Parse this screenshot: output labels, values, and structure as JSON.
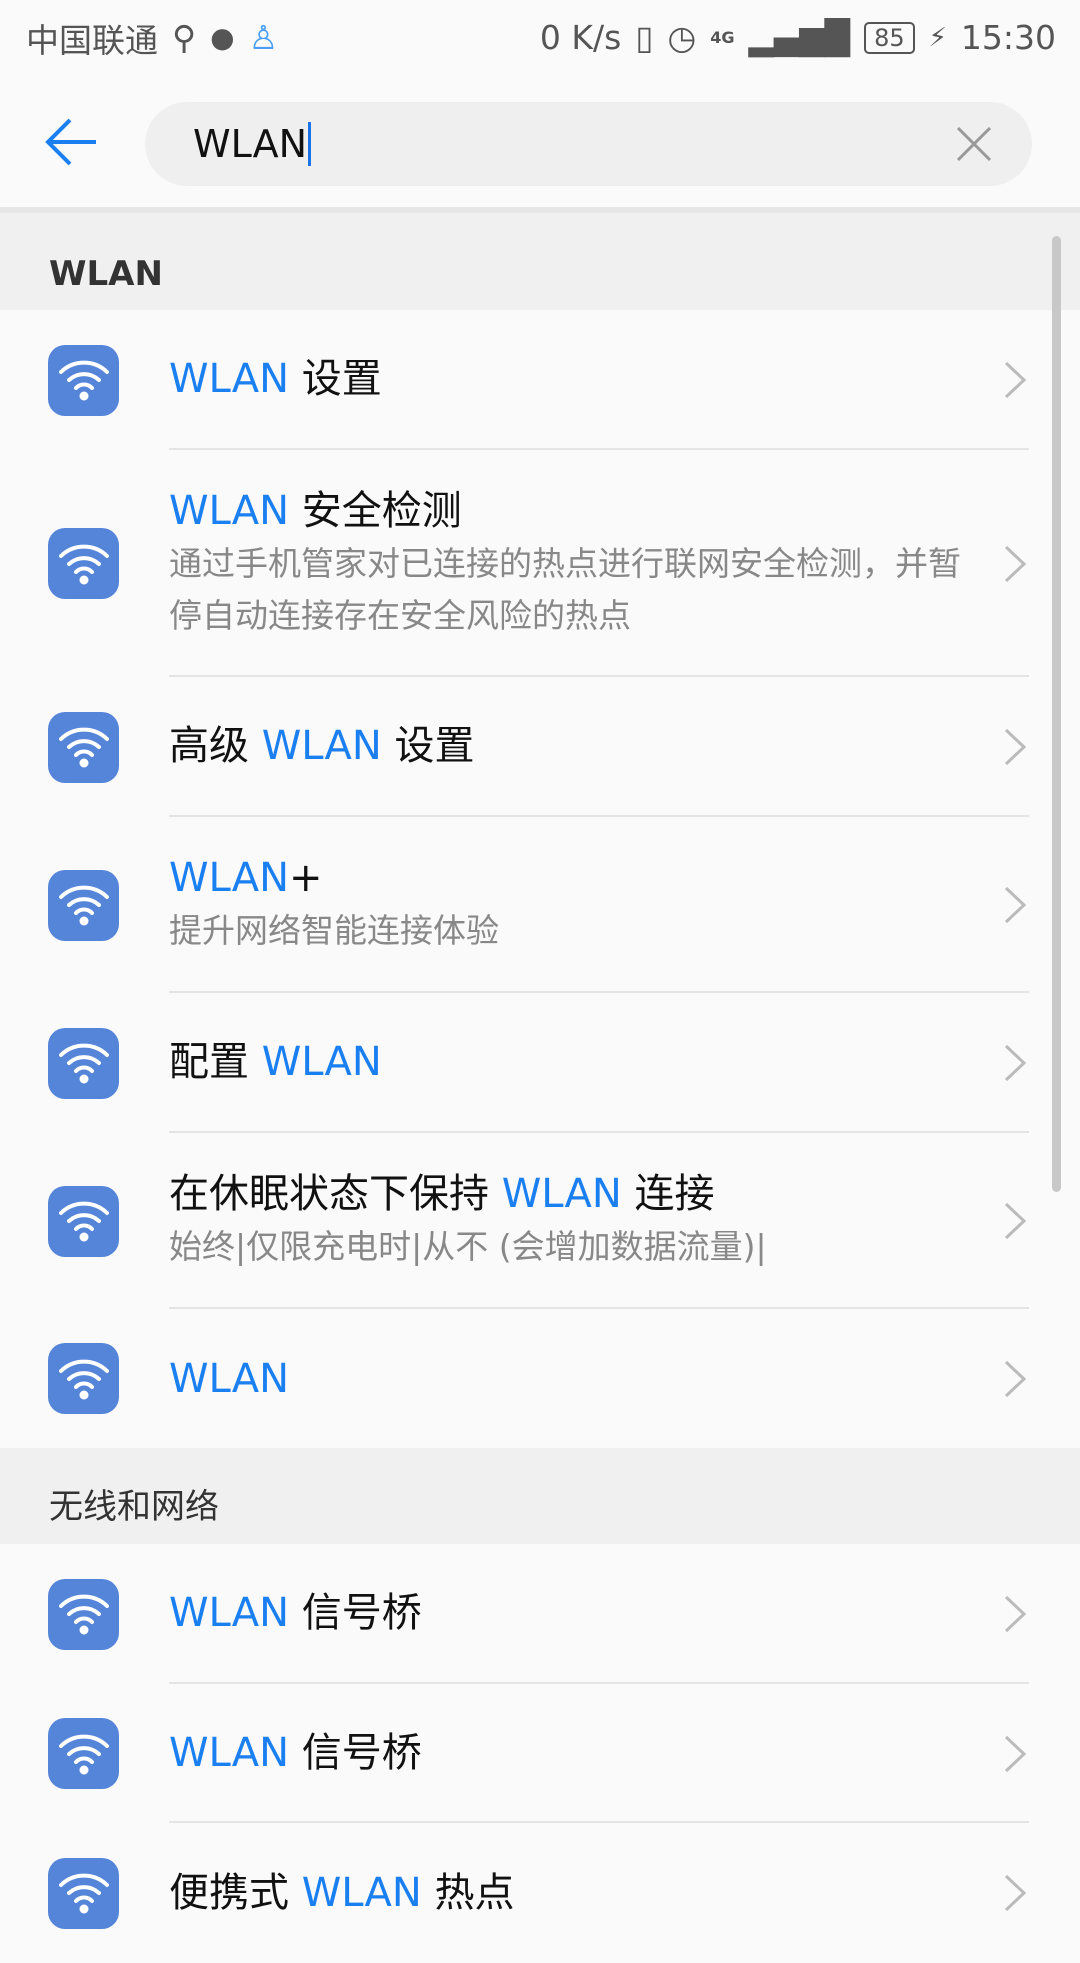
{
  "status_bar": {
    "carrier": "中国联通",
    "speed": "0 K/s",
    "network": "4G",
    "battery": "85",
    "time": "15:30"
  },
  "search": {
    "value": "WLAN"
  },
  "sections": [
    {
      "title": "WLAN",
      "items": [
        {
          "pre": "",
          "hl": "WLAN",
          "post": " 设置",
          "sub": ""
        },
        {
          "pre": "",
          "hl": "WLAN",
          "post": " 安全检测",
          "sub": "通过手机管家对已连接的热点进行联网安全检测，并暂停自动连接存在安全风险的热点"
        },
        {
          "pre": "高级 ",
          "hl": "WLAN",
          "post": " 设置",
          "sub": ""
        },
        {
          "pre": "",
          "hl": "WLAN",
          "post": "+",
          "sub": "提升网络智能连接体验"
        },
        {
          "pre": "配置 ",
          "hl": "WLAN",
          "post": "",
          "sub": ""
        },
        {
          "pre": "在休眠状态下保持 ",
          "hl": "WLAN",
          "post": " 连接",
          "sub": "始终|仅限充电时|从不 (会增加数据流量)|"
        },
        {
          "pre": "",
          "hl": "WLAN",
          "post": "",
          "sub": ""
        }
      ]
    },
    {
      "title": "无线和网络",
      "items": [
        {
          "pre": "",
          "hl": "WLAN",
          "post": " 信号桥",
          "sub": ""
        },
        {
          "pre": "",
          "hl": "WLAN",
          "post": " 信号桥",
          "sub": ""
        },
        {
          "pre": "便携式 ",
          "hl": "WLAN",
          "post": " 热点",
          "sub": ""
        }
      ]
    }
  ],
  "colors": {
    "accent": "#1a7ff0",
    "icon_bg": "#5585d9"
  }
}
